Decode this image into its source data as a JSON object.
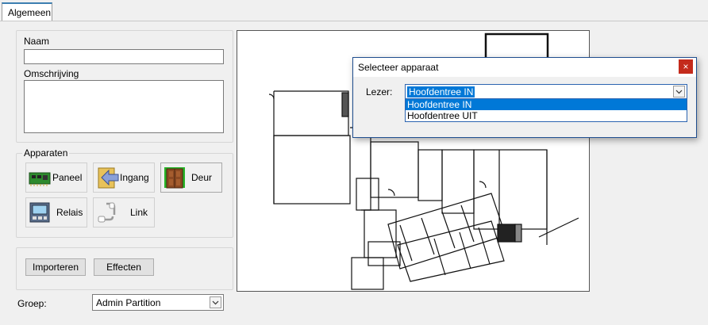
{
  "tabs": [
    {
      "label": "Algemeen",
      "active": true
    }
  ],
  "form": {
    "naam_label": "Naam",
    "naam_value": "",
    "omschrijving_label": "Omschrijving",
    "omschrijving_value": ""
  },
  "apparaten": {
    "title": "Apparaten",
    "buttons": [
      {
        "label": "Paneel",
        "icon": "circuit-board-icon"
      },
      {
        "label": "Ingang",
        "icon": "entry-arrow-icon"
      },
      {
        "label": "Deur",
        "icon": "door-icon"
      },
      {
        "label": "Relais",
        "icon": "relay-icon"
      },
      {
        "label": "Link",
        "icon": "link-icon"
      }
    ]
  },
  "actions": {
    "import_label": "Importeren",
    "effects_label": "Effecten"
  },
  "groep": {
    "label": "Groep:",
    "value": "Admin Partition"
  },
  "dialog": {
    "title": "Selecteer apparaat",
    "close_glyph": "×",
    "lezer_label": "Lezer:",
    "selected": "Hoofdentree IN",
    "options": [
      "Hoofdentree IN",
      "Hoofdentree UIT"
    ]
  },
  "colors": {
    "accent": "#0078d7",
    "close": "#c42b1c",
    "tab_border": "#3c7fb1"
  }
}
